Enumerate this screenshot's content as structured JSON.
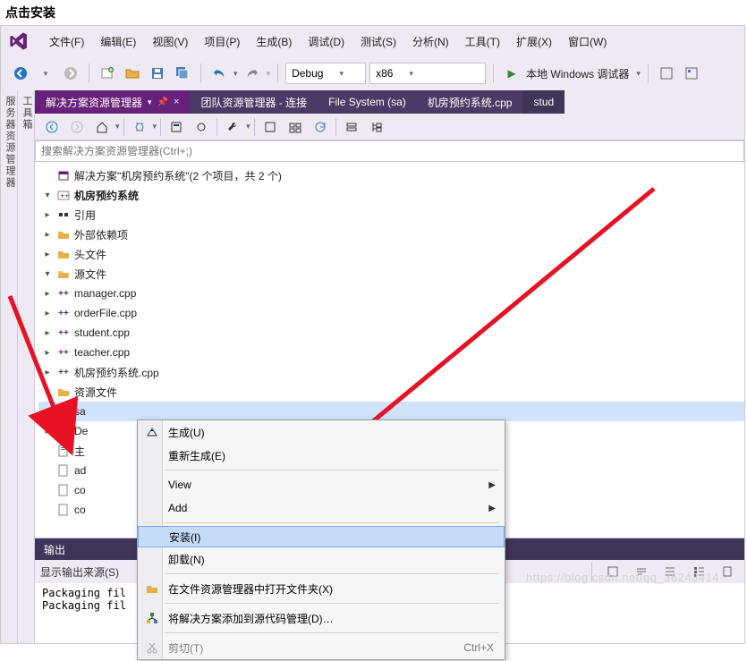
{
  "caption": "点击安装",
  "menubar": {
    "items": [
      "文件(F)",
      "编辑(E)",
      "视图(V)",
      "项目(P)",
      "生成(B)",
      "调试(D)",
      "测试(S)",
      "分析(N)",
      "工具(T)",
      "扩展(X)",
      "窗口(W)"
    ]
  },
  "toolbar": {
    "config": "Debug",
    "platform": "x86",
    "debug_target": "本地 Windows 调试器"
  },
  "vertical_tabs": {
    "a": "服务器资源管理器",
    "b": "工具箱"
  },
  "tabs": {
    "t0": {
      "label": "解决方案资源管理器"
    },
    "t1": {
      "label": "团队资源管理器 - 连接"
    },
    "t2": {
      "label": "File System (sa)"
    },
    "t3": {
      "label": "机房预约系统.cpp"
    },
    "t4": {
      "label": "stud"
    }
  },
  "search": {
    "placeholder": "搜索解决方案资源管理器(Ctrl+;)"
  },
  "tree": {
    "solution": "解决方案\"机房预约系统\"(2 个项目，共 2 个)",
    "proj": "机房预约系统",
    "refs": "引用",
    "ext": "外部依赖项",
    "headers": "头文件",
    "sources": "源文件",
    "src": {
      "f0": "manager.cpp",
      "f1": "orderFile.cpp",
      "f2": "student.cpp",
      "f3": "teacher.cpp",
      "f4": "机房预约系统.cpp"
    },
    "resources": "资源文件",
    "sa": "sa",
    "de": "De",
    "zhu": "主",
    "ad": "ad",
    "co1": "co",
    "co2": "co"
  },
  "context_menu": {
    "build": "生成(U)",
    "rebuild": "重新生成(E)",
    "view": "View",
    "add": "Add",
    "install": "安装(I)",
    "uninstall": "卸载(N)",
    "open_folder": "在文件资源管理器中打开文件夹(X)",
    "add_scm": "将解决方案添加到源代码管理(D)…",
    "cut": "剪切(T)",
    "cut_key": "Ctrl+X"
  },
  "output": {
    "title": "输出",
    "source_label": "显示输出来源(S)",
    "lines": {
      "l0": "Packaging fil",
      "l1": "Packaging fil"
    }
  },
  "watermark": "https://blog.csdn.net/qq_36243414"
}
